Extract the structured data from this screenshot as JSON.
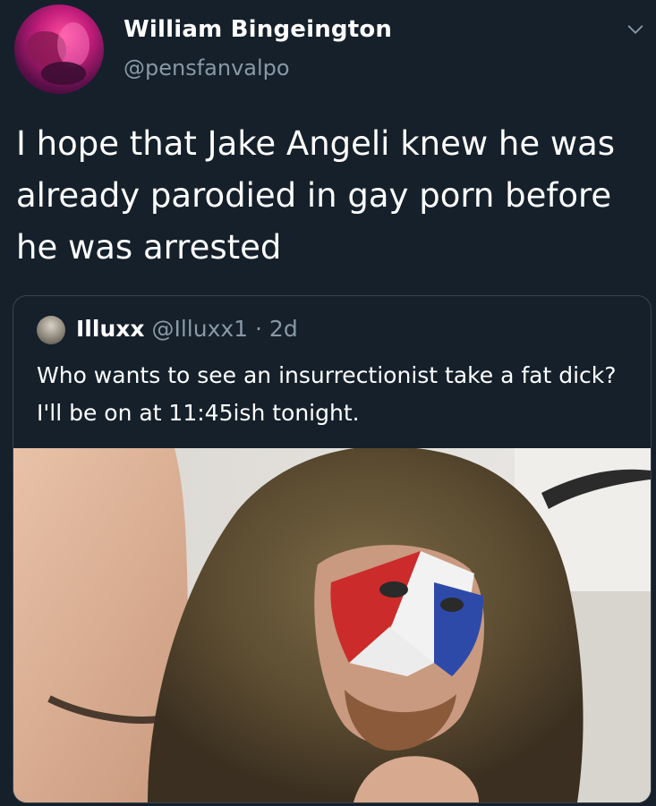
{
  "tweet": {
    "author_name": "William Bingeington",
    "author_handle": "@pensfanvalpo",
    "text": "I hope that Jake Angeli knew he was already parodied in gay porn before he was arrested"
  },
  "quoted_tweet": {
    "author_name": "Illuxx",
    "author_handle": "@Illuxx1",
    "separator": "·",
    "time": "2d",
    "text": "Who wants to see an insurrectionist take a fat dick? I'll be on at 11:45ish tonight."
  },
  "icons": {
    "menu": "chevron-down-icon"
  },
  "colors": {
    "background": "#15202b",
    "secondary_text": "#8899a6",
    "border": "#38444d"
  }
}
